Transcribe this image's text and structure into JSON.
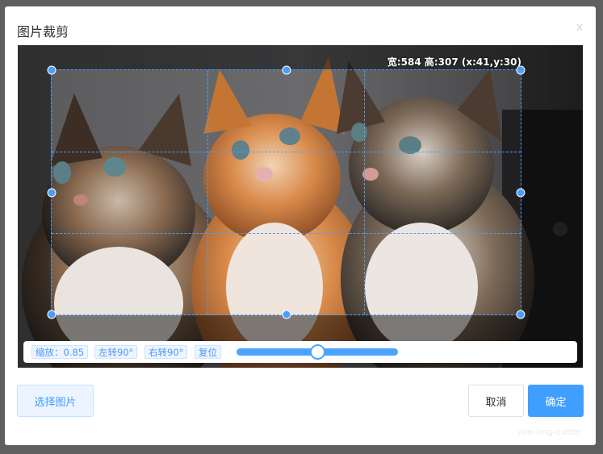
{
  "dialog": {
    "title": "图片裁剪",
    "close_label": "x"
  },
  "cropper": {
    "size_info": "宽:584 高:307 (x:41,y:30)",
    "toolbar": {
      "zoom_label": "缩放：0.85",
      "rotate_left_label": "左转90°",
      "rotate_right_label": "右转90°",
      "reset_label": "复位",
      "slider_fraction": 0.5
    }
  },
  "footer": {
    "choose_image_label": "选择图片",
    "cancel_label": "取消",
    "confirm_label": "确定",
    "watermark": "vue-img-cutter"
  },
  "colors": {
    "accent": "#409eff",
    "crop_line": "#48a0ff",
    "handle": "#4a9ef8"
  }
}
